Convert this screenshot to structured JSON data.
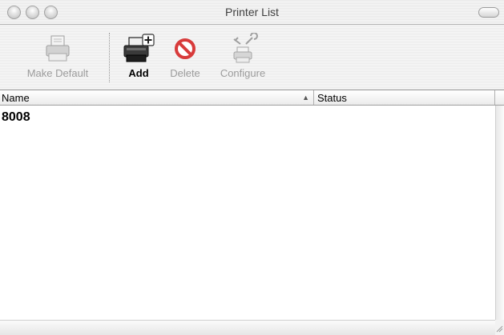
{
  "window": {
    "title": "Printer List"
  },
  "toolbar": {
    "make_default_label": "Make Default",
    "add_label": "Add",
    "delete_label": "Delete",
    "configure_label": "Configure",
    "icons": {
      "make_default": "printer-icon",
      "add": "add-printer-icon",
      "delete": "delete-icon",
      "configure": "configure-tools-icon"
    }
  },
  "table": {
    "columns": [
      {
        "label": "Name",
        "sorted": "ascending"
      },
      {
        "label": "Status"
      }
    ],
    "rows": [
      {
        "name": "8008",
        "status": ""
      }
    ]
  },
  "colors": {
    "disabled_text": "#9b9b9b",
    "delete_icon": "#d83b3b"
  }
}
